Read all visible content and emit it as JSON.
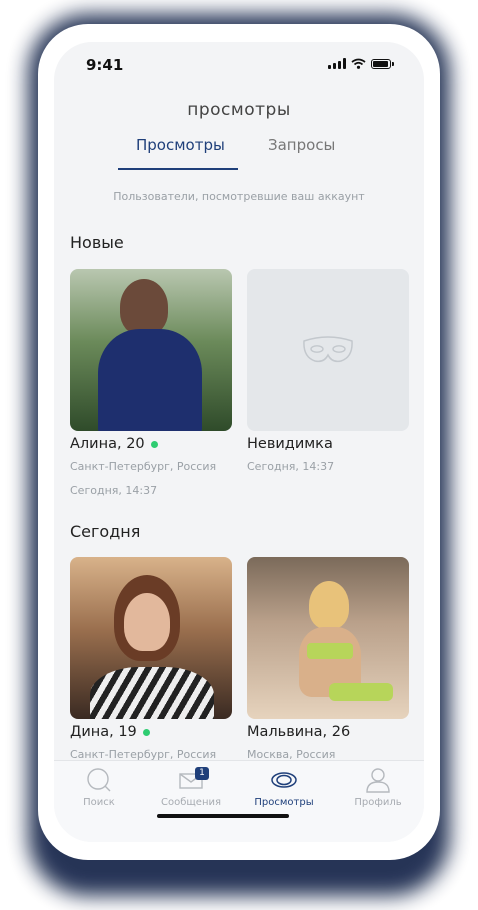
{
  "status": {
    "time": "9:41"
  },
  "header": {
    "title": "просмотры"
  },
  "tabs": [
    {
      "label": "Просмотры",
      "active": true
    },
    {
      "label": "Запросы",
      "active": false
    }
  ],
  "subtitle": "Пользователи, посмотревшие ваш аккаунт",
  "sections": [
    {
      "title": "Новые",
      "cards": [
        {
          "name": "Алина, 20",
          "online": true,
          "location": "Санкт-Петербург, Россия",
          "time": "Сегодня, 14:37"
        },
        {
          "name": "Невидимка",
          "online": false,
          "location": "Сегодня, 14:37"
        }
      ]
    },
    {
      "title": "Сегодня",
      "cards": [
        {
          "name": "Дина, 19",
          "online": true,
          "location": "Санкт-Петербург, Россия"
        },
        {
          "name": "Мальвина, 26",
          "online": false,
          "location": "Москва, Россия"
        }
      ]
    }
  ],
  "nav": [
    {
      "label": "Поиск",
      "icon": "search-icon"
    },
    {
      "label": "Сообщения",
      "icon": "envelope-icon",
      "badge": "1"
    },
    {
      "label": "Просмотры",
      "icon": "eye-icon",
      "active": true
    },
    {
      "label": "Профиль",
      "icon": "user-icon"
    }
  ],
  "colors": {
    "accent": "#1f3f7a",
    "online": "#2ecc71",
    "background": "#f3f4f6"
  }
}
